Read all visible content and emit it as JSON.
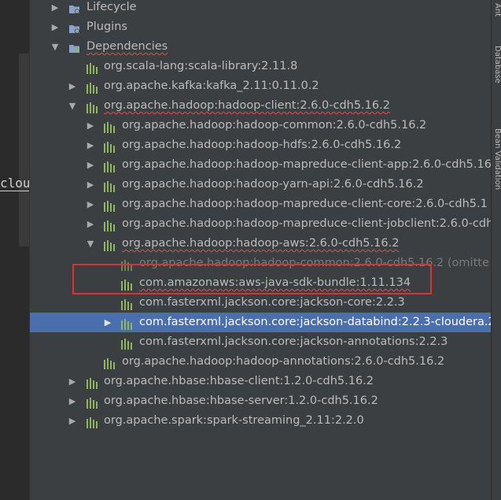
{
  "editor": {
    "cut_text": "clou"
  },
  "right_bar": {
    "tabs": [
      "Ant",
      "Database",
      "Bean Validation"
    ]
  },
  "tree": {
    "rows": [
      {
        "label": "Lifecycle",
        "indent": 0,
        "arrow": "collapsed",
        "icon": "folder-gear",
        "style": "normal"
      },
      {
        "label": "Plugins",
        "indent": 0,
        "arrow": "collapsed",
        "icon": "folder-gear",
        "style": "normal"
      },
      {
        "label": "Dependencies",
        "indent": 0,
        "arrow": "expanded",
        "icon": "folder-lib",
        "style": "err"
      },
      {
        "label": "org.scala-lang:scala-library:2.11.8",
        "indent": 1,
        "arrow": "none",
        "icon": "library",
        "style": "normal"
      },
      {
        "label": "org.apache.kafka:kafka_2.11:0.11.0.2",
        "indent": 1,
        "arrow": "collapsed",
        "icon": "library",
        "style": "normal"
      },
      {
        "label": "org.apache.hadoop:hadoop-client:2.6.0-cdh5.16.2",
        "indent": 1,
        "arrow": "expanded",
        "icon": "library",
        "style": "err"
      },
      {
        "label": "org.apache.hadoop:hadoop-common:2.6.0-cdh5.16.2",
        "indent": 2,
        "arrow": "collapsed",
        "icon": "library",
        "style": "normal"
      },
      {
        "label": "org.apache.hadoop:hadoop-hdfs:2.6.0-cdh5.16.2",
        "indent": 2,
        "arrow": "collapsed",
        "icon": "library",
        "style": "normal"
      },
      {
        "label": "org.apache.hadoop:hadoop-mapreduce-client-app:2.6.0-cdh5.16",
        "indent": 2,
        "arrow": "collapsed",
        "icon": "library",
        "style": "normal"
      },
      {
        "label": "org.apache.hadoop:hadoop-yarn-api:2.6.0-cdh5.16.2",
        "indent": 2,
        "arrow": "collapsed",
        "icon": "library",
        "style": "normal"
      },
      {
        "label": "org.apache.hadoop:hadoop-mapreduce-client-core:2.6.0-cdh5.1",
        "indent": 2,
        "arrow": "collapsed",
        "icon": "library",
        "style": "normal"
      },
      {
        "label": "org.apache.hadoop:hadoop-mapreduce-client-jobclient:2.6.0-cdh",
        "indent": 2,
        "arrow": "collapsed",
        "icon": "library",
        "style": "normal"
      },
      {
        "label": "org.apache.hadoop:hadoop-aws:2.6.0-cdh5.16.2",
        "indent": 2,
        "arrow": "expanded",
        "icon": "library",
        "style": "err"
      },
      {
        "label": "org.apache.hadoop:hadoop-common:2.6.0-cdh5.16.2 (omitte",
        "indent": 3,
        "arrow": "none",
        "icon": "library-dim",
        "style": "omitted"
      },
      {
        "label": "com.amazonaws:aws-java-sdk-bundle:1.11.134",
        "indent": 3,
        "arrow": "none",
        "icon": "library",
        "style": "err"
      },
      {
        "label": "com.fasterxml.jackson.core:jackson-core:2.2.3",
        "indent": 3,
        "arrow": "none",
        "icon": "library",
        "style": "normal"
      },
      {
        "label": "com.fasterxml.jackson.core:jackson-databind:2.2.3-cloudera.2",
        "indent": 3,
        "arrow": "collapsed",
        "icon": "library",
        "style": "selected"
      },
      {
        "label": "com.fasterxml.jackson.core:jackson-annotations:2.2.3",
        "indent": 3,
        "arrow": "none",
        "icon": "library",
        "style": "normal"
      },
      {
        "label": "org.apache.hadoop:hadoop-annotations:2.6.0-cdh5.16.2",
        "indent": 2,
        "arrow": "none",
        "icon": "library",
        "style": "normal"
      },
      {
        "label": "org.apache.hbase:hbase-client:1.2.0-cdh5.16.2",
        "indent": 1,
        "arrow": "collapsed",
        "icon": "library",
        "style": "normal"
      },
      {
        "label": "org.apache.hbase:hbase-server:1.2.0-cdh5.16.2",
        "indent": 1,
        "arrow": "collapsed",
        "icon": "library",
        "style": "normal"
      },
      {
        "label": "org.apache.spark:spark-streaming_2.11:2.2.0",
        "indent": 1,
        "arrow": "collapsed",
        "icon": "library",
        "style": "normal"
      }
    ]
  },
  "colors": {
    "panel_bg": "#3c3f41",
    "selection": "#4b6eaf",
    "highlight_box": "#e03030",
    "library_icon": "#8fb55e",
    "folder_icon": "#8aa4c8"
  }
}
